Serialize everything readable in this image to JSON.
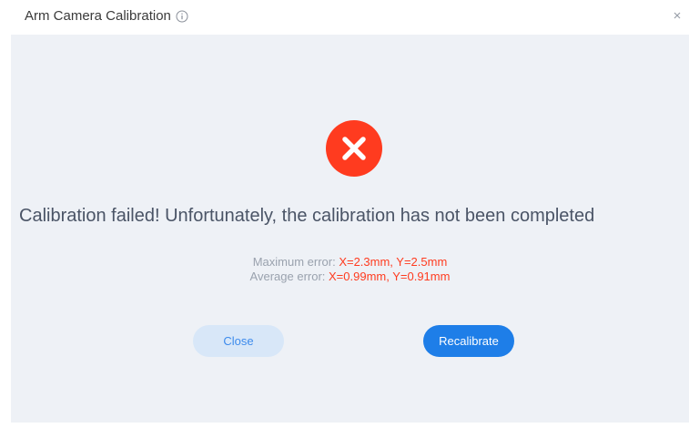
{
  "dialog": {
    "title": "Arm Camera Calibration",
    "info_icon": "info-circle-icon",
    "close_icon": "close-icon",
    "close_glyph": "×"
  },
  "result": {
    "status_icon": "error-x-icon",
    "headline": "Calibration failed! Unfortunately, the calibration has not been completed",
    "max_error_label": "Maximum error: ",
    "max_error_value": "X=2.3mm, Y=2.5mm",
    "avg_error_label": "Average error: ",
    "avg_error_value": "X=0.99mm, Y=0.91mm"
  },
  "actions": {
    "close_label": "Close",
    "recalibrate_label": "Recalibrate"
  },
  "colors": {
    "error_red": "#ff3b1f",
    "primary_blue": "#1e7ee8",
    "secondary_blue_bg": "#d8e7f8",
    "panel_bg": "#eef1f6"
  }
}
